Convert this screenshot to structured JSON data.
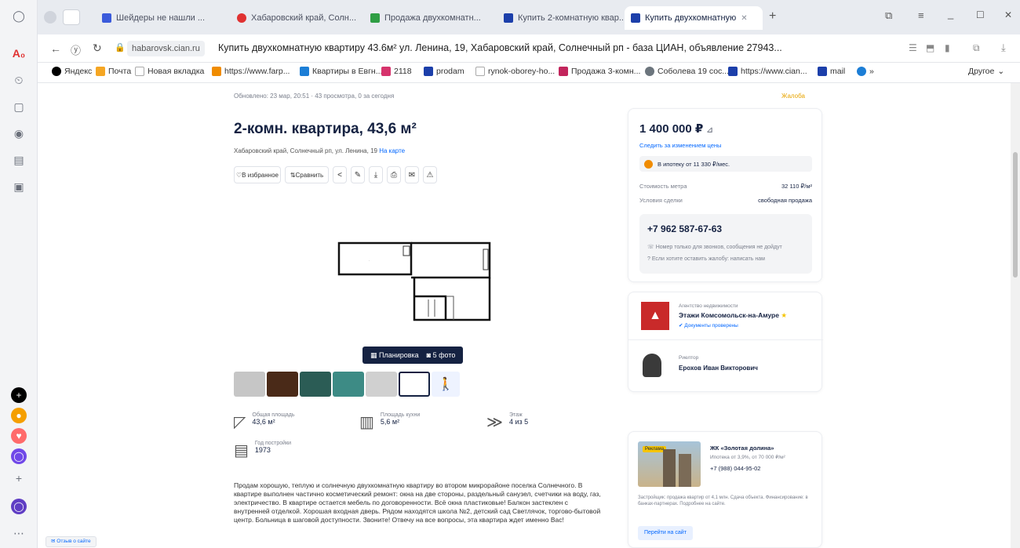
{
  "browser": {
    "tabs": [
      {
        "label": "Шейдеры не нашли ...",
        "color": "#3b5bdb"
      },
      {
        "label": "Хабаровский край, Солн...",
        "color": "#e03131"
      },
      {
        "label": "Продажа двухкомнатн...",
        "color": "#2f9e44"
      },
      {
        "label": "Купить 2-комнатную квар...",
        "color": "#1c3faa"
      },
      {
        "label": "Купить двухкомнатную",
        "color": "#1c3faa"
      }
    ],
    "domain": "habarovsk.cian.ru",
    "page_title": "Купить двухкомнатную квартиру 43.6м² ул. Ленина, 19, Хабаровский край, Солнечный рп - база ЦИАН, объявление 27943...",
    "bookmarks": [
      {
        "label": "Яндекс",
        "color": "#000000"
      },
      {
        "label": "Почта",
        "color": "#f5a623"
      },
      {
        "label": "Новая вкладка",
        "color": "#cccccc"
      },
      {
        "label": "https://www.farp...",
        "color": "#f08c00"
      },
      {
        "label": "Квартиры в Евгн...",
        "color": "#1c7ed6"
      },
      {
        "label": "2118",
        "color": "#d6336c"
      },
      {
        "label": "prodam",
        "color": "#1c3faa"
      },
      {
        "label": "rynok-oborey-ho...",
        "color": "#cccccc"
      },
      {
        "label": "Продажа 3-комн...",
        "color": "#c2255c"
      },
      {
        "label": "Соболева 19 сос...",
        "color": "#6c757d"
      },
      {
        "label": "https://www.cian...",
        "color": "#1c3faa"
      },
      {
        "label": "mail",
        "color": "#1c3faa"
      }
    ],
    "other_label": "Другое"
  },
  "listing": {
    "meta": "Обновлено: 23 мар, 20:51 · 43 просмотра, 0 за сегодня",
    "report": "Жалоба",
    "title": "2-комн. квартира, 43,6 м²",
    "address": "Хабаровский край, Солнечный рп, ул. Ленина, 19",
    "map_link": "На карте",
    "actions": {
      "favorite": "В избранное",
      "compare": "Сравнить"
    },
    "photo_buttons": {
      "plan": "Планировка",
      "photos": "5 фото"
    },
    "params": [
      {
        "label": "Общая площадь",
        "value": "43,6 м²"
      },
      {
        "label": "Площадь кухни",
        "value": "5,6 м²"
      },
      {
        "label": "Этаж",
        "value": "4 из 5"
      },
      {
        "label": "Год постройки",
        "value": "1973"
      }
    ],
    "description": "Продам хорошую, теплую и солнечную двухкомнатную квартиру во втором микрорайоне поселка Солнечного. В квартире выполнен частично косметический ремонт: окна на две стороны, раздельный санузел, счетчики на воду, газ, электричество. В квартире остается мебель по договоренности. Всё окна пластиковые! Балкон застеклен с внутренней отделкой. Хорошая входная дверь. Рядом находятся школа №2, детский сад Светлячок, торгово-бытовой центр. Больница в шаговой доступности. Звоните! Отвечу на все вопросы, эта квартира ждет именно Вас!"
  },
  "sidebar": {
    "price": "1 400 000 ₽",
    "price_change_link": "Следить за изменением цены",
    "mortgage": "В ипотеку от 11 330 ₽/мес.",
    "rows": [
      {
        "label": "Стоимость метра",
        "value": "32 110 ₽/м²"
      },
      {
        "label": "Условия сделки",
        "value": "свободная продажа"
      }
    ],
    "phone": "+7 962 587-67-63",
    "phone_note": "Номер только для звонков, сообщения не дойдут",
    "complaint_note": "Если хотите оставить жалобу: написать нам",
    "agency_label": "Агентство недвижимости",
    "agency_name": "Этажи Комсомольск-на-Амуре",
    "agency_docs": "Документы проверены",
    "agent_label": "Риелтор",
    "agent_name": "Ерохов Иван Викторович",
    "ad": {
      "badge": "Реклама",
      "title": "ЖК «Золотая долина»",
      "subtitle": "Ипотека от 3,9%, от 70 000 ₽/м²",
      "phone": "+7 (988) 044-95-02",
      "text": "Застройщик: продажа квартир от 4,1 млн. Сдача объекта. Финансирование: в банках-партнерах. Подробнее на сайте.",
      "button": "Перейти на сайт"
    }
  },
  "floating_link": "Отзыв о сайте",
  "colors": {
    "brand": "#0468ff",
    "dark": "#152242",
    "plan_button": "#152242"
  }
}
